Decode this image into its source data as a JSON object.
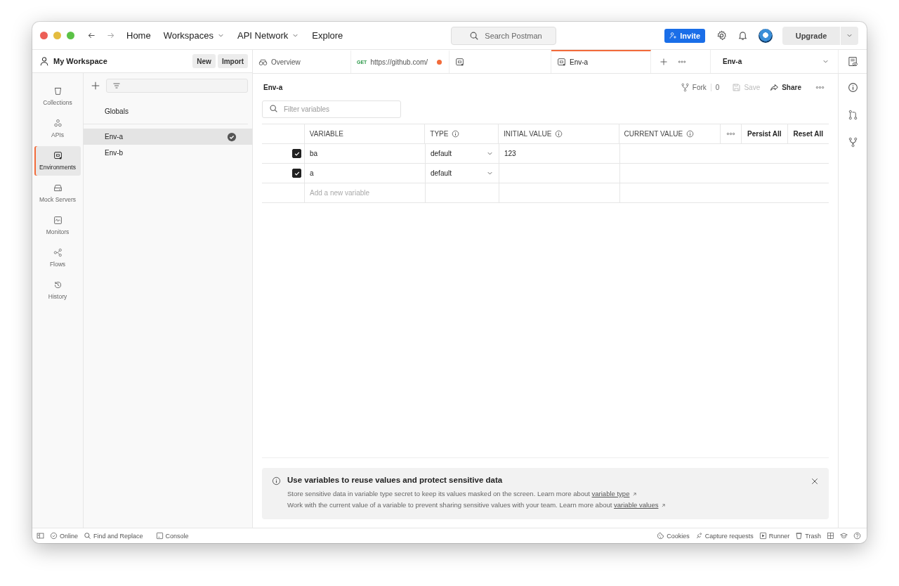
{
  "nav": {
    "items": [
      {
        "label": "Home",
        "dropdown": false
      },
      {
        "label": "Workspaces",
        "dropdown": true
      },
      {
        "label": "API Network",
        "dropdown": true
      },
      {
        "label": "Explore",
        "dropdown": false
      }
    ],
    "search": {
      "placeholder": "Search Postman"
    },
    "invite": "Invite",
    "upgrade": "Upgrade"
  },
  "workspace": {
    "title": "My Workspace",
    "buttons": [
      "New",
      "Import"
    ]
  },
  "sidebar": {
    "items": [
      {
        "label": "Collections",
        "selected": false
      },
      {
        "label": "APIs",
        "selected": false
      },
      {
        "label": "Environments",
        "selected": true
      },
      {
        "label": "Mock Servers",
        "selected": false
      },
      {
        "label": "Monitors",
        "selected": false
      },
      {
        "label": "Flows",
        "selected": false
      },
      {
        "label": "History",
        "selected": false
      }
    ]
  },
  "environments": [
    {
      "name": "Globals",
      "selected": false,
      "active": false
    },
    {
      "name": "Env-a",
      "selected": true,
      "active": true
    },
    {
      "name": "Env-b",
      "selected": false,
      "active": false
    }
  ],
  "tabs": [
    {
      "kind": "overview",
      "label": "Overview",
      "selected": false
    },
    {
      "kind": "request",
      "method": "GET",
      "label": "https://github.com/",
      "unsaved": true,
      "selected": false
    },
    {
      "kind": "environment",
      "selected": false
    },
    {
      "kind": "environment",
      "label": "Env-a",
      "selected": true
    }
  ],
  "env_selector": "Env-a",
  "editor": {
    "title": "Env-a",
    "fork": "Fork",
    "fork_count": "0",
    "save": {
      "label": "Save",
      "disabled": true
    },
    "share": "Share",
    "filter": {
      "placeholder": "Filter variables"
    }
  },
  "table": {
    "columns": [
      {
        "label": "VARIABLE",
        "info": false
      },
      {
        "label": "TYPE",
        "info": true
      },
      {
        "label": "INITIAL VALUE",
        "info": true
      },
      {
        "label": "CURRENT VALUE",
        "info": true
      }
    ],
    "actions": [
      "Persist All",
      "Reset All"
    ],
    "rows": [
      {
        "enabled": true,
        "variable": "ba",
        "type": "default",
        "initial": "123"
      },
      {
        "enabled": true,
        "variable": "a",
        "type": "default"
      }
    ],
    "new_row": {
      "placeholder": "Add a new variable"
    }
  },
  "banner": {
    "title": "Use variables to reuse values and protect sensitive data",
    "lines": [
      {
        "text": "Store sensitive data in variable type secret to keep its values masked on the screen. Learn more about",
        "link": "variable type"
      },
      {
        "text": "Work with the current value of a variable to prevent sharing sensitive values with your team. Learn more about",
        "link": "variable values"
      }
    ]
  },
  "status_bar": {
    "left": [
      {
        "kind": "online",
        "label": "Online"
      },
      {
        "kind": "find",
        "label": "Find and Replace"
      },
      {
        "kind": "console",
        "label": "Console"
      }
    ],
    "right": [
      {
        "kind": "cookies",
        "label": "Cookies"
      },
      {
        "kind": "capture",
        "label": "Capture requests"
      },
      {
        "kind": "runner",
        "label": "Runner"
      },
      {
        "kind": "trash",
        "label": "Trash"
      }
    ]
  }
}
